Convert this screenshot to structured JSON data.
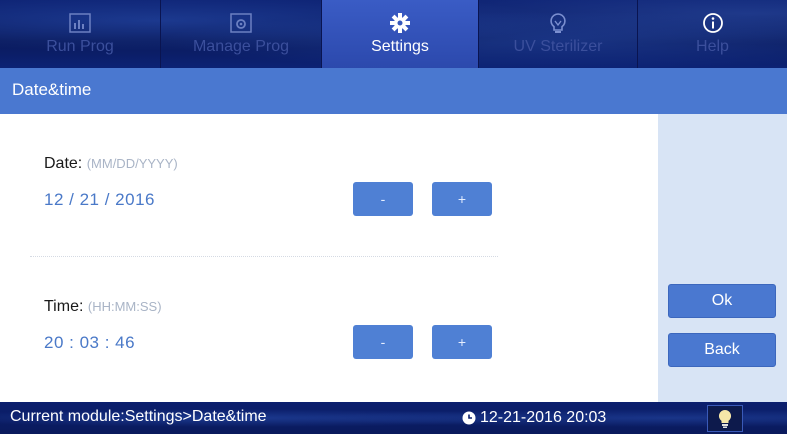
{
  "nav": {
    "tabs": [
      {
        "label": "Run Prog",
        "icon": "bar-chart-icon",
        "active": false
      },
      {
        "label": "Manage Prog",
        "icon": "settings-box-icon",
        "active": false
      },
      {
        "label": "Settings",
        "icon": "gear-icon",
        "active": true
      },
      {
        "label": "UV Sterilizer",
        "icon": "uv-bulb-icon",
        "active": false
      },
      {
        "label": "Help",
        "icon": "info-icon",
        "active": false
      }
    ]
  },
  "page": {
    "title": "Date&time"
  },
  "date": {
    "label": "Date:",
    "format": "(MM/DD/YYYY)",
    "value": "12 / 21 / 2016",
    "minus": "-",
    "plus": "+"
  },
  "time": {
    "label": "Time:",
    "format": "(HH:MM:SS)",
    "value": "20 : 03 : 46",
    "minus": "-",
    "plus": "+"
  },
  "actions": {
    "ok": "Ok",
    "back": "Back"
  },
  "status": {
    "module": "Current module:Settings>Date&time",
    "datetime": "12-21-2016 20:03"
  },
  "colors": {
    "accent": "#4a78d0",
    "nav_bg": "#0b1f6e",
    "panel": "#d8e4f5",
    "value_text": "#4a79c8"
  }
}
